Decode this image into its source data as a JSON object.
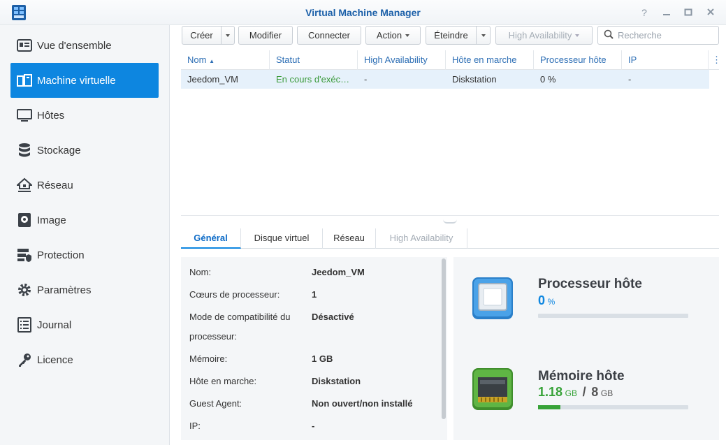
{
  "window": {
    "title": "Virtual Machine Manager"
  },
  "sidebar": {
    "items": [
      {
        "label": "Vue d'ensemble"
      },
      {
        "label": "Machine virtuelle"
      },
      {
        "label": "Hôtes"
      },
      {
        "label": "Stockage"
      },
      {
        "label": "Réseau"
      },
      {
        "label": "Image"
      },
      {
        "label": "Protection"
      },
      {
        "label": "Paramètres"
      },
      {
        "label": "Journal"
      },
      {
        "label": "Licence"
      }
    ]
  },
  "toolbar": {
    "create": "Créer",
    "modify": "Modifier",
    "connect": "Connecter",
    "action": "Action",
    "shutdown": "Éteindre",
    "high_availability": "High Availability",
    "search_placeholder": "Recherche"
  },
  "table": {
    "columns": [
      "Nom",
      "Statut",
      "High Availability",
      "Hôte en marche",
      "Processeur hôte",
      "IP"
    ],
    "rows": [
      {
        "name": "Jeedom_VM",
        "status": "En cours d'exécution",
        "ha": "-",
        "host": "Diskstation",
        "cpu": "0 %",
        "ip": "-"
      }
    ]
  },
  "tabs": [
    "Général",
    "Disque virtuel",
    "Réseau",
    "High Availability"
  ],
  "details": [
    {
      "label": "Nom:",
      "value": "Jeedom_VM"
    },
    {
      "label": "Cœurs de processeur:",
      "value": "1"
    },
    {
      "label": "Mode de compatibilité du",
      "value": "Désactivé"
    },
    {
      "label": "processeur:",
      "value": ""
    },
    {
      "label": "Mémoire:",
      "value": "1 GB"
    },
    {
      "label": "Hôte en marche:",
      "value": "Diskstation"
    },
    {
      "label": "Guest Agent:",
      "value": "Non ouvert/non installé"
    },
    {
      "label": "IP:",
      "value": "-"
    }
  ],
  "resources": {
    "cpu": {
      "title": "Processeur hôte",
      "value": "0",
      "unit": "%",
      "usage_percent": 0
    },
    "memory": {
      "title": "Mémoire hôte",
      "used": "1.18",
      "used_unit": "GB",
      "separator": "/",
      "total": "8",
      "total_unit": "GB",
      "usage_fraction": 0.1475
    }
  },
  "colors": {
    "accent": "#0d86e0",
    "success": "#3a9a3a",
    "cpu_value": "#0d86e0",
    "memory_value": "#37a238"
  }
}
